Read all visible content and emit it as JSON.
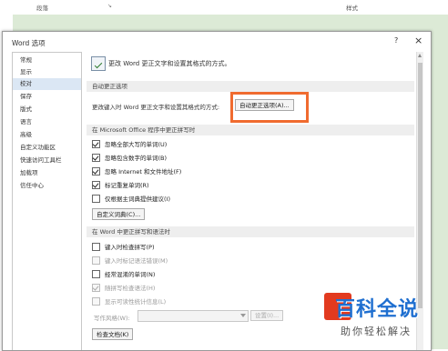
{
  "topbar": {
    "left_label": "段落",
    "middle_label": "↘",
    "right_label": "样式"
  },
  "dialog": {
    "title": "Word 选项",
    "help_label": "?",
    "close_label": "×"
  },
  "nav": {
    "items": [
      "常规",
      "显示",
      "校对",
      "保存",
      "版式",
      "语言",
      "高级",
      "自定义功能区",
      "快速访问工具栏",
      "加载项",
      "信任中心"
    ],
    "selected_index": 2
  },
  "content": {
    "header_text": "更改 Word 更正文字和设置其格式的方式。",
    "autocorrect_section": "自动更正选项",
    "autocorrect_text": "更改键入时 Word 更正文字和设置其格式的方式:",
    "autocorrect_button": "自动更正选项(A)...",
    "office_section": "在 Microsoft Office 程序中更正拼写时",
    "office_options": [
      {
        "label": "忽略全部大写的单词(U)",
        "checked": true
      },
      {
        "label": "忽略包含数字的单词(B)",
        "checked": true
      },
      {
        "label": "忽略 Internet 和文件地址(F)",
        "checked": true
      },
      {
        "label": "标记重复单词(R)",
        "checked": true
      },
      {
        "label": "仅根据主词典提供建议(I)",
        "checked": false
      }
    ],
    "custom_dict_button": "自定义词典(C)...",
    "word_section": "在 Word 中更正拼写和语法时",
    "word_options": [
      {
        "label": "键入时检查拼写(P)",
        "checked": false,
        "disabled": false
      },
      {
        "label": "键入时标记语法错误(M)",
        "checked": false,
        "disabled": true
      },
      {
        "label": "经常混淆的单词(N)",
        "checked": false,
        "disabled": false
      },
      {
        "label": "随拼写检查语法(H)",
        "checked": true,
        "disabled": true
      },
      {
        "label": "显示可读性统计信息(L)",
        "checked": false,
        "disabled": true
      }
    ],
    "writing_style_label": "写作风格(W):",
    "settings_button": "设置(I)...",
    "check_doc_button": "检查文档(K)"
  },
  "watermark": {
    "big": "百科全说",
    "small": "助你轻松解决"
  },
  "colors": {
    "highlight": "#f06b2f",
    "selected_nav": "#dbe7f4",
    "greenbg": "#dcead6"
  }
}
